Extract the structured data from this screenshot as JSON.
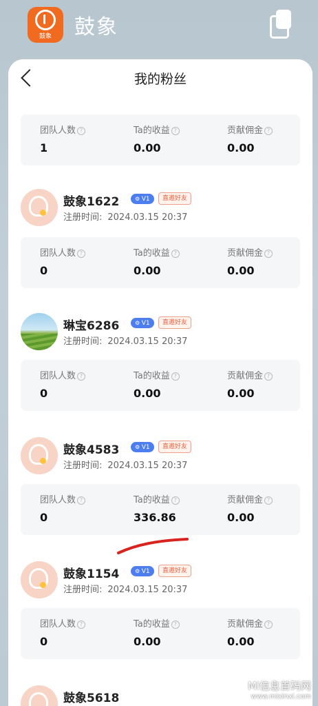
{
  "app": {
    "name": "鼓象",
    "logo_text": "鼓象"
  },
  "nav": {
    "title": "我的粉丝"
  },
  "labels": {
    "team_count": "团队人数",
    "ta_income": "Ta的收益",
    "commission": "贡献佣金",
    "registered": "注册时间:",
    "level_badge": "V1",
    "friend_badge": "直邀好友"
  },
  "first_stats": {
    "team_count": "1",
    "ta_income": "0.00",
    "commission": "0.00"
  },
  "users": [
    {
      "name": "鼓象1622",
      "registered_at": "2024.03.15 20:37",
      "team_count": "0",
      "ta_income": "0.00",
      "commission": "0.00",
      "avatar": "elephant-avatar"
    },
    {
      "name": "琳宝6286",
      "registered_at": "2024.03.15 20:37",
      "team_count": "0",
      "ta_income": "0.00",
      "commission": "0.00",
      "avatar": "landscape-photo"
    },
    {
      "name": "鼓象4583",
      "registered_at": "2024.03.15 20:37",
      "team_count": "0",
      "ta_income": "336.86",
      "commission": "0.00",
      "avatar": "elephant-avatar"
    },
    {
      "name": "鼓象1154",
      "registered_at": "2024.03.15 20:37",
      "team_count": "0",
      "ta_income": "0.00",
      "commission": "0.00",
      "avatar": "elephant-avatar"
    },
    {
      "name": "鼓象5618",
      "avatar": "elephant-avatar"
    }
  ],
  "watermark": {
    "line1": "Mi信息首码网",
    "line2": "www.mixinxi.com"
  },
  "colors": {
    "brand": "#f06a1f",
    "badge_blue": "#4d7ef0",
    "badge_red": "#e8623e",
    "annotation": "#d9231f"
  }
}
